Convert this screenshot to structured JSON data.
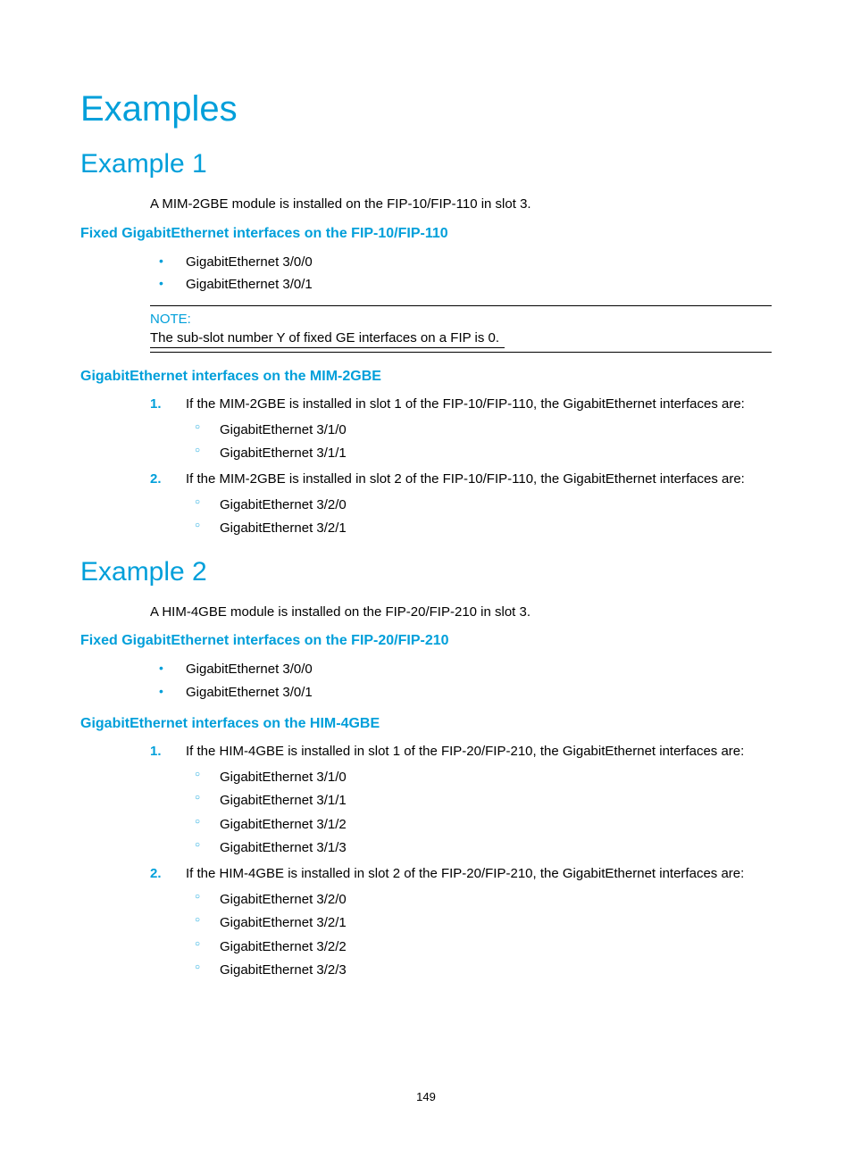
{
  "page_number": "149",
  "title": "Examples",
  "example1": {
    "heading": "Example 1",
    "intro": "A MIM-2GBE module is installed on the FIP-10/FIP-110 in slot 3.",
    "section_a": {
      "heading": "Fixed GigabitEthernet interfaces on the FIP-10/FIP-110",
      "items": [
        "GigabitEthernet 3/0/0",
        "GigabitEthernet 3/0/1"
      ]
    },
    "note": {
      "label": "NOTE:",
      "text": "The sub-slot number Y of fixed GE interfaces on a FIP is 0."
    },
    "section_b": {
      "heading": "GigabitEthernet interfaces on the MIM-2GBE",
      "items": [
        {
          "num": "1.",
          "text": "If the MIM-2GBE is installed in slot 1 of the FIP-10/FIP-110, the GigabitEthernet interfaces are:",
          "sub": [
            "GigabitEthernet 3/1/0",
            "GigabitEthernet 3/1/1"
          ]
        },
        {
          "num": "2.",
          "text": "If the MIM-2GBE is installed in slot 2 of the FIP-10/FIP-110, the GigabitEthernet interfaces are:",
          "sub": [
            "GigabitEthernet 3/2/0",
            "GigabitEthernet 3/2/1"
          ]
        }
      ]
    }
  },
  "example2": {
    "heading": "Example 2",
    "intro": "A HIM-4GBE module is installed on the FIP-20/FIP-210 in slot 3.",
    "section_a": {
      "heading": "Fixed GigabitEthernet interfaces on the FIP-20/FIP-210",
      "items": [
        "GigabitEthernet 3/0/0",
        "GigabitEthernet 3/0/1"
      ]
    },
    "section_b": {
      "heading": "GigabitEthernet interfaces on the HIM-4GBE",
      "items": [
        {
          "num": "1.",
          "text": "If the HIM-4GBE is installed in slot 1 of the FIP-20/FIP-210, the GigabitEthernet interfaces are:",
          "sub": [
            "GigabitEthernet 3/1/0",
            "GigabitEthernet 3/1/1",
            "GigabitEthernet 3/1/2",
            "GigabitEthernet 3/1/3"
          ]
        },
        {
          "num": "2.",
          "text": "If the HIM-4GBE is installed in slot 2 of the FIP-20/FIP-210, the GigabitEthernet interfaces are:",
          "sub": [
            "GigabitEthernet 3/2/0",
            "GigabitEthernet 3/2/1",
            "GigabitEthernet 3/2/2",
            "GigabitEthernet 3/2/3"
          ]
        }
      ]
    }
  }
}
